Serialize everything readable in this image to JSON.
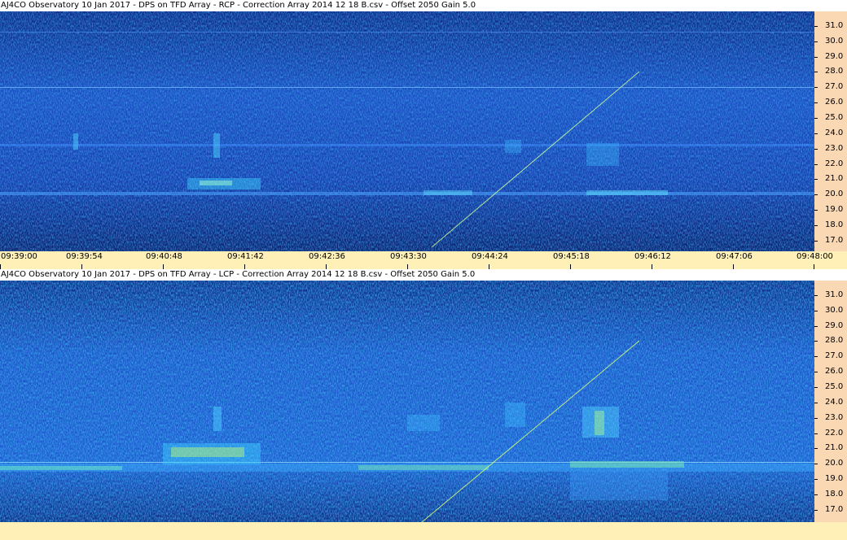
{
  "panels": [
    {
      "title": "AJ4CO Observatory 10 Jan 2017  -  DPS on TFD Array  -  RCP  -  Correction Array 2014 12 18 B.csv  -  Offset 2050  Gain 5.0",
      "y_ticks": [
        "31.0",
        "30.0",
        "29.0",
        "28.0",
        "27.0",
        "26.0",
        "25.0",
        "24.0",
        "23.0",
        "22.0",
        "21.0",
        "20.0",
        "19.0",
        "18.0",
        "17.0"
      ]
    },
    {
      "title": "AJ4CO Observatory 10 Jan 2017  -  DPS on TFD Array  -  LCP  -  Correction Array 2014 12 18 B.csv  -  Offset 2050  Gain 5.0",
      "y_ticks": [
        "31.0",
        "30.0",
        "29.0",
        "28.0",
        "27.0",
        "26.0",
        "25.0",
        "24.0",
        "23.0",
        "22.0",
        "21.0",
        "20.0",
        "19.0",
        "18.0",
        "17.0"
      ]
    }
  ],
  "time_axis": [
    "09:39:00",
    "09:39:54",
    "09:40:48",
    "09:41:42",
    "09:42:36",
    "09:43:30",
    "09:44:24",
    "09:45:18",
    "09:46:12",
    "09:47:06",
    "09:48:00"
  ],
  "colors": {
    "background": "#0e2f8a",
    "signal": "#3a8cff",
    "hot": "#f4f742",
    "axis_bg": "#fbd8b4",
    "time_bar": "#fff0b8"
  }
}
